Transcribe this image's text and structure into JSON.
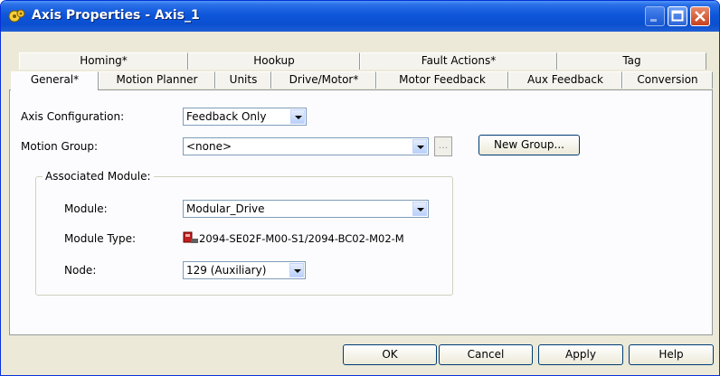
{
  "window": {
    "title": "Axis Properties - Axis_1"
  },
  "tabs_back": [
    {
      "label": "Homing*"
    },
    {
      "label": "Hookup"
    },
    {
      "label": "Fault Actions*"
    },
    {
      "label": "Tag"
    }
  ],
  "tabs_front": [
    {
      "label": "General*"
    },
    {
      "label": "Motion Planner"
    },
    {
      "label": "Units"
    },
    {
      "label": "Drive/Motor*"
    },
    {
      "label": "Motor Feedback"
    },
    {
      "label": "Aux Feedback"
    },
    {
      "label": "Conversion"
    }
  ],
  "form": {
    "axis_configuration": {
      "label": "Axis Configuration:",
      "value": "Feedback Only"
    },
    "motion_group": {
      "label": "Motion Group:",
      "value": "<none>",
      "browse_label": "...",
      "new_group_label": "New Group..."
    }
  },
  "associated_module": {
    "legend": "Associated Module:",
    "module": {
      "label": "Module:",
      "value": "Modular_Drive"
    },
    "module_type": {
      "label": "Module Type:",
      "value": "2094-SE02F-M00-S1/2094-BC02-M02-M"
    },
    "node": {
      "label": "Node:",
      "value": "129 (Auxiliary)"
    }
  },
  "buttons": {
    "ok": "OK",
    "cancel": "Cancel",
    "apply": "Apply",
    "help": "Help"
  },
  "colors": {
    "titlebar": "#0a4fd0",
    "dialog_bg": "#ece9d8",
    "panel_bg": "#fcfcfe"
  }
}
